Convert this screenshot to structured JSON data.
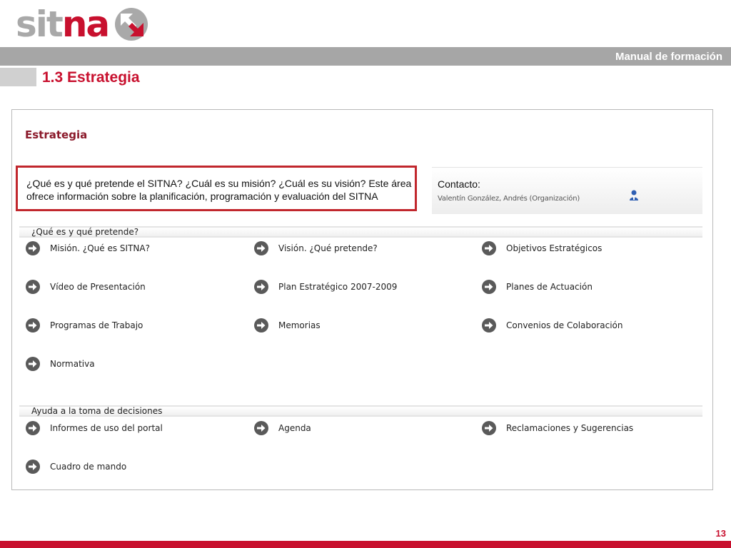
{
  "brand": {
    "logo_part1": "sit",
    "logo_part2": "na",
    "logo_color_gray": "#a9a9a9",
    "logo_color_red": "#c8102e"
  },
  "header": {
    "manual_title": "Manual de formación",
    "section_heading": "1.3 Estrategia",
    "page_number": "13"
  },
  "screen": {
    "title": "Estrategia",
    "intro_line1": "¿Qué es y qué pretende el SITNA? ¿Cuál es su misión? ¿Cuál es su visión? Este área",
    "intro_line2": "ofrece información sobre la planificación, programación y evaluación del SITNA",
    "contact": {
      "label": "Contacto:",
      "name": "Valentín González, Andrés (Organización)",
      "icon": "user-icon"
    },
    "sections": [
      {
        "title": "¿Qué es y qué pretende?",
        "links": [
          "Misión. ¿Qué es SITNA?",
          "Visión. ¿Qué pretende?",
          "Objetivos Estratégicos",
          "Vídeo de Presentación",
          "Plan Estratégico 2007-2009",
          "Planes de Actuación",
          "Programas de Trabajo",
          "Memorias",
          "Convenios de Colaboración",
          "Normativa"
        ]
      },
      {
        "title": "Ayuda a la toma de decisiones",
        "links": [
          "Informes de uso del portal",
          "Agenda",
          "Reclamaciones y Sugerencias",
          "Cuadro de mando"
        ]
      }
    ],
    "link_icon": "arrow-right-circle-icon"
  }
}
